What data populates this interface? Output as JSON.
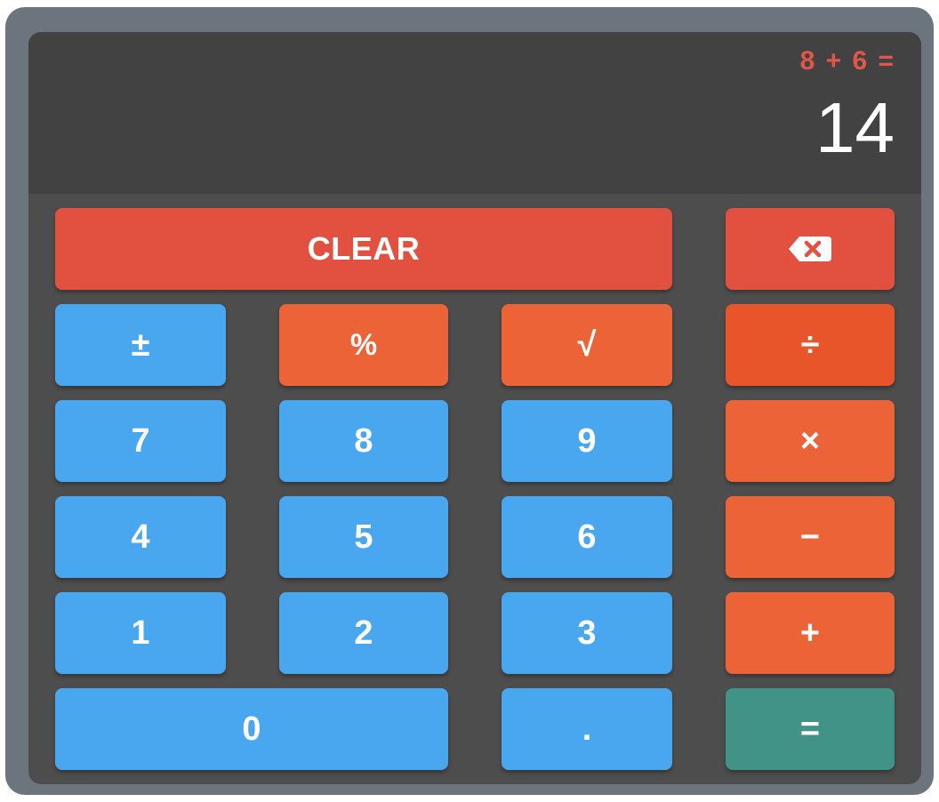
{
  "display": {
    "expression": "8 + 6 =",
    "result": "14"
  },
  "buttons": {
    "clear": "CLEAR",
    "backspace_icon": "backspace-icon",
    "plus_minus": "±",
    "percent": "%",
    "sqrt": "√",
    "divide": "÷",
    "seven": "7",
    "eight": "8",
    "nine": "9",
    "multiply": "×",
    "four": "4",
    "five": "5",
    "six": "6",
    "minus": "−",
    "one": "1",
    "two": "2",
    "three": "3",
    "plus": "+",
    "zero": "0",
    "decimal": ".",
    "equals": "="
  },
  "colors": {
    "frame": "#6c757d",
    "panel": "#4d4d4d",
    "display": "#424242",
    "expression": "#e2574a",
    "number_button": "#48a7ef",
    "operator_button": "#ec6337",
    "clear_button": "#e2513f",
    "equals_button": "#419287"
  }
}
